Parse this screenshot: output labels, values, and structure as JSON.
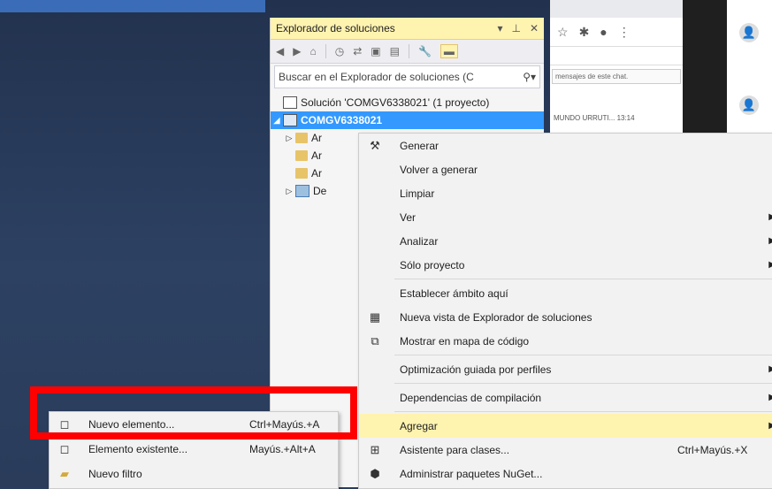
{
  "solution_explorer": {
    "title": "Explorador de soluciones",
    "title_controls": [
      "▾",
      "⊥",
      "✕"
    ],
    "search_placeholder": "Buscar en el Explorador de soluciones (C",
    "tree": [
      {
        "label": "Solución 'COMGV6338021' (1 proyecto)",
        "twisty": "",
        "icon": "solution-icon"
      },
      {
        "label": "COMGV6338021",
        "twisty": "◢",
        "icon": "project-icon",
        "selected": true
      },
      {
        "label": "Ar",
        "twisty": "▷",
        "icon": "folder-icon"
      },
      {
        "label": "Ar",
        "twisty": "",
        "icon": "folder-icon"
      },
      {
        "label": "Ar",
        "twisty": "",
        "icon": "folder-icon"
      },
      {
        "label": "De",
        "twisty": "▷",
        "icon": "references-icon"
      }
    ]
  },
  "browser": {
    "chat_input": "mensajes de este chat.",
    "chat_item_name": "MUNDO URRUTI...",
    "chat_item_time": "13:14"
  },
  "context_menu": {
    "items": [
      {
        "label": "Generar",
        "icon": "build-icon"
      },
      {
        "label": "Volver a generar"
      },
      {
        "label": "Limpiar"
      },
      {
        "label": "Ver",
        "submenu": true
      },
      {
        "label": "Analizar",
        "submenu": true
      },
      {
        "label": "Sólo proyecto",
        "submenu": true
      },
      {
        "separator": true
      },
      {
        "label": "Establecer ámbito aquí"
      },
      {
        "label": "Nueva vista de Explorador de soluciones",
        "icon": "new-view-icon"
      },
      {
        "label": "Mostrar en mapa de código",
        "icon": "code-map-icon"
      },
      {
        "separator": true
      },
      {
        "label": "Optimización guiada por perfiles",
        "submenu": true
      },
      {
        "separator": true
      },
      {
        "label": "Dependencias de compilación",
        "submenu": true
      },
      {
        "separator": true
      },
      {
        "label": "Agregar",
        "submenu": true,
        "highlighted": true
      },
      {
        "label": "Asistente para clases...",
        "icon": "class-wizard-icon",
        "shortcut": "Ctrl+Mayús.+X"
      },
      {
        "label": "Administrar paquetes NuGet...",
        "icon": "nuget-icon"
      }
    ]
  },
  "add_submenu": {
    "items": [
      {
        "label": "Nuevo elemento...",
        "shortcut": "Ctrl+Mayús.+A",
        "icon": "new-item-icon"
      },
      {
        "label": "Elemento existente...",
        "shortcut": "Mayús.+Alt+A",
        "icon": "existing-item-icon"
      },
      {
        "label": "Nuevo filtro",
        "icon": "new-filter-icon"
      }
    ]
  },
  "colors": {
    "highlight": "#fff3b0",
    "selection": "#3399ff",
    "annotation": "#ff0000"
  }
}
